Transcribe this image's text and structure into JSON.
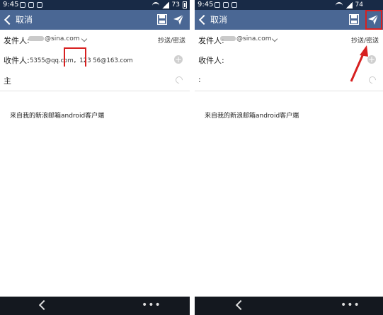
{
  "left": {
    "status": {
      "time": "9:45",
      "battery": "73"
    },
    "appbar": {
      "cancel": "取消"
    },
    "compose": {
      "from_label": "发件人:",
      "from_value": "@sina.com",
      "cc_bcc": "抄送/密送",
      "to_label": "收件人:",
      "to_value": "5355@qq.com，123  56@163.com",
      "subject_label": "主",
      "body": "来自我的新浪邮箱android客户端"
    }
  },
  "right": {
    "status": {
      "time": "9:45",
      "battery": "74"
    },
    "appbar": {
      "cancel": "取消"
    },
    "compose": {
      "from_label": "发件人:",
      "from_value": "@sina.com",
      "cc_bcc": "抄送/密送",
      "to_label": "收件人:",
      "to_value": "",
      "subject_label": ":",
      "body": "来自我的新浪邮箱android客户端"
    }
  },
  "colors": {
    "appbar": "#4a6794",
    "statusbar": "#182a46",
    "navbar": "#14181f",
    "highlight": "#d72020"
  },
  "icons": [
    "chevron-left-icon",
    "save-icon",
    "send-icon",
    "plus-icon",
    "paperclip-icon",
    "back-icon",
    "more-icon"
  ]
}
